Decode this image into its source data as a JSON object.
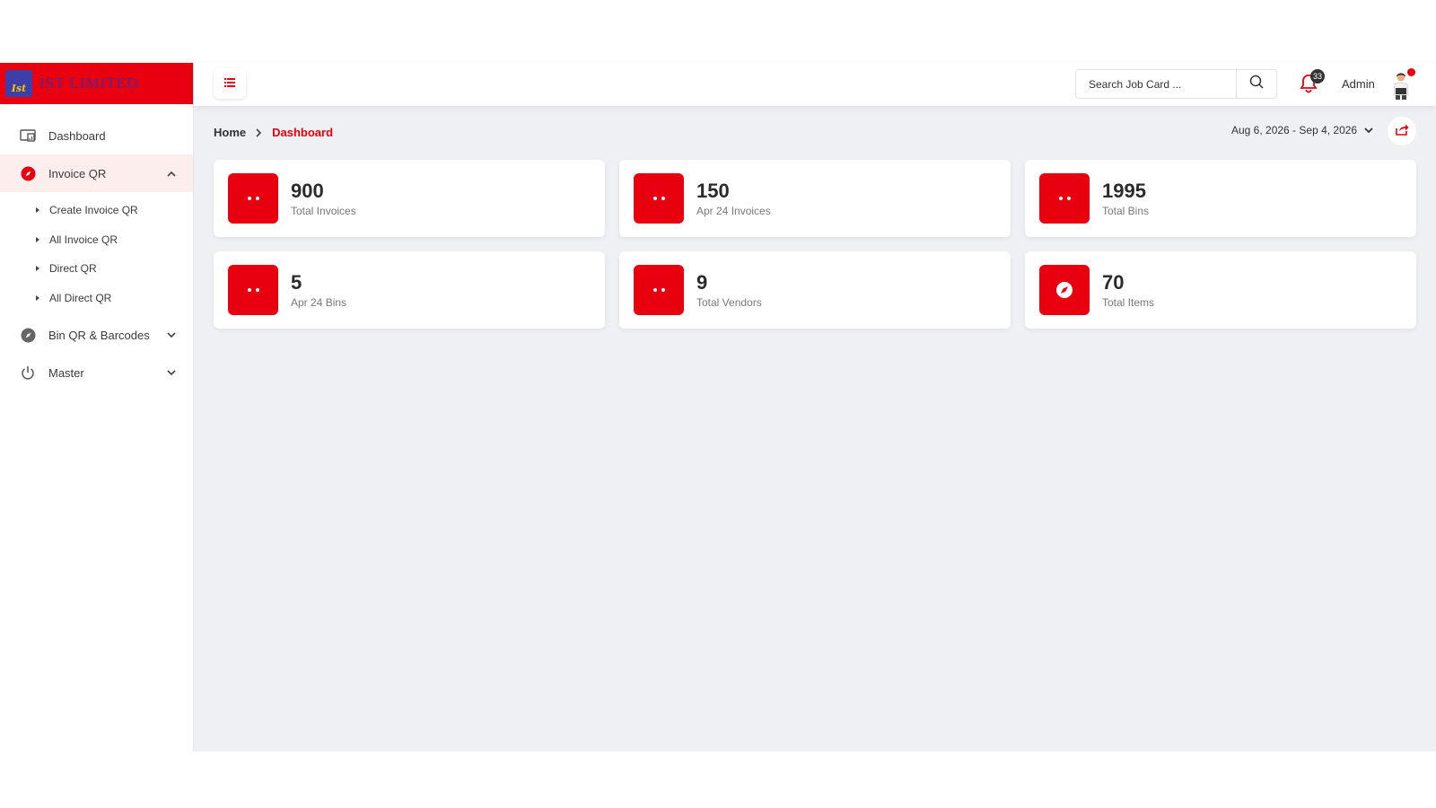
{
  "brand": {
    "logo_text": "Ist",
    "name": "IST LIMITED"
  },
  "sidebar": {
    "items": [
      {
        "label": "Dashboard",
        "icon": "dashboard-icon"
      },
      {
        "label": "Invoice QR",
        "icon": "compass-icon",
        "expanded": true
      },
      {
        "label": "Bin QR & Barcodes",
        "icon": "compass-icon"
      },
      {
        "label": "Master",
        "icon": "power-icon"
      }
    ],
    "invoice_sub": [
      "Create Invoice QR",
      "All Invoice QR",
      "Direct QR",
      "All Direct QR"
    ]
  },
  "header": {
    "search_placeholder": "Search Job Card ...",
    "notifications_count": "33",
    "user_name": "Admin"
  },
  "breadcrumb": {
    "home": "Home",
    "current": "Dashboard"
  },
  "date_range": "Aug 6, 2026 - Sep 4, 2026",
  "stats": [
    {
      "value": "900",
      "label": "Total Invoices",
      "icon": "dots-icon"
    },
    {
      "value": "150",
      "label": "Apr 24 Invoices",
      "icon": "dots-icon"
    },
    {
      "value": "1995",
      "label": "Total Bins",
      "icon": "dots-icon"
    },
    {
      "value": "5",
      "label": "Apr 24 Bins",
      "icon": "dots-icon"
    },
    {
      "value": "9",
      "label": "Total Vendors",
      "icon": "dots-icon"
    },
    {
      "value": "70",
      "label": "Total Items",
      "icon": "compass-icon"
    }
  ],
  "colors": {
    "accent": "#e8000e",
    "background": "#eff0f4",
    "sidebar_active": "#fdeeee"
  }
}
